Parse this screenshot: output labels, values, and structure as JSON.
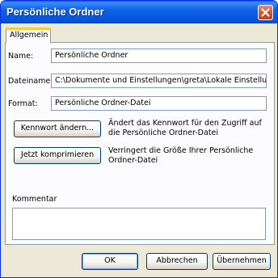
{
  "window": {
    "title": "Persönliche Ordner"
  },
  "tabs": [
    {
      "label": "Allgemein"
    }
  ],
  "form": {
    "name_label": "Name:",
    "name_value": "Persönliche Ordner",
    "filename_label": "Dateiname:",
    "filename_value": "C:\\Dokumente und Einstellungen\\greta\\Lokale Einstellun",
    "format_label": "Format:",
    "format_value": "Persönliche Ordner-Datei"
  },
  "actions": {
    "password_button": "Kennwort ändern...",
    "password_desc": "Ändert das Kennwort für den Zugriff auf die Persönliche Ordner-Datei",
    "compact_button": "Jetzt komprimieren",
    "compact_desc": "Verringert die Größe Ihrer Persönliche Ordner-Datei"
  },
  "comment": {
    "label": "Kommentar",
    "value": ""
  },
  "footer": {
    "ok": "OK",
    "cancel": "Abbrechen",
    "apply": "Übernehmen"
  },
  "colors": {
    "titlebar": "#0454d9",
    "dialog_bg": "#ece9d8",
    "tab_highlight": "#ffc73c",
    "close_button": "#d4582f"
  },
  "icons": {
    "close": "close-icon"
  }
}
